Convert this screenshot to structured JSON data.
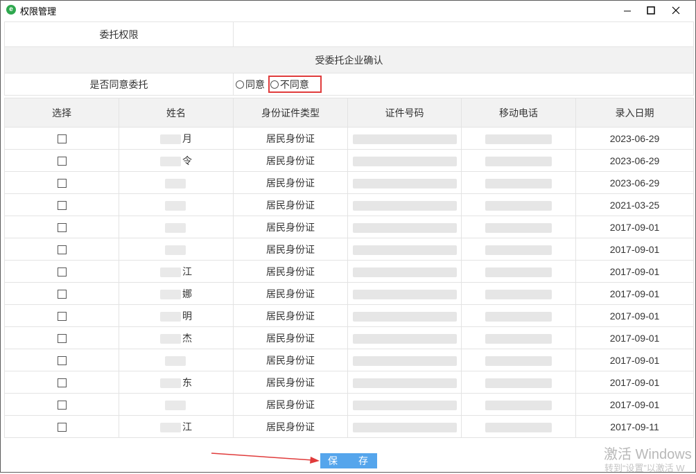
{
  "window": {
    "title": "权限管理",
    "app_icon": "e"
  },
  "delegation": {
    "label": "委托权限",
    "section_title": "受委托企业确认",
    "agree_question": "是否同意委托",
    "options": [
      "同意",
      "不同意"
    ],
    "highlighted_option": "不同意"
  },
  "table": {
    "headers": [
      "选择",
      "姓名",
      "身份证件类型",
      "证件号码",
      "移动电话",
      "录入日期"
    ],
    "rows": [
      {
        "name": "月",
        "id_type": "居民身份证",
        "date": "2023-06-29"
      },
      {
        "name": "令",
        "id_type": "居民身份证",
        "date": "2023-06-29"
      },
      {
        "name": "",
        "id_type": "居民身份证",
        "date": "2023-06-29"
      },
      {
        "name": "",
        "id_type": "居民身份证",
        "date": "2021-03-25"
      },
      {
        "name": "",
        "id_type": "居民身份证",
        "date": "2017-09-01"
      },
      {
        "name": "",
        "id_type": "居民身份证",
        "date": "2017-09-01"
      },
      {
        "name": "江",
        "id_type": "居民身份证",
        "date": "2017-09-01"
      },
      {
        "name": "娜",
        "id_type": "居民身份证",
        "date": "2017-09-01"
      },
      {
        "name": "明",
        "id_type": "居民身份证",
        "date": "2017-09-01"
      },
      {
        "name": "杰",
        "id_type": "居民身份证",
        "date": "2017-09-01"
      },
      {
        "name": "",
        "id_type": "居民身份证",
        "date": "2017-09-01"
      },
      {
        "name": "东",
        "id_type": "居民身份证",
        "date": "2017-09-01"
      },
      {
        "name": "",
        "id_type": "居民身份证",
        "date": "2017-09-01"
      },
      {
        "name": "江",
        "id_type": "居民身份证",
        "date": "2017-09-11"
      }
    ]
  },
  "actions": {
    "save_left": "保",
    "save_right": "存"
  },
  "watermark": {
    "title": "激活 Windows",
    "subtitle": "转到“设置”以激活 W"
  },
  "colors": {
    "save_button": "#55a5ec",
    "highlight_box": "#e03b3b",
    "arrow": "#e03b3b",
    "header_bg": "#f2f2f2"
  }
}
